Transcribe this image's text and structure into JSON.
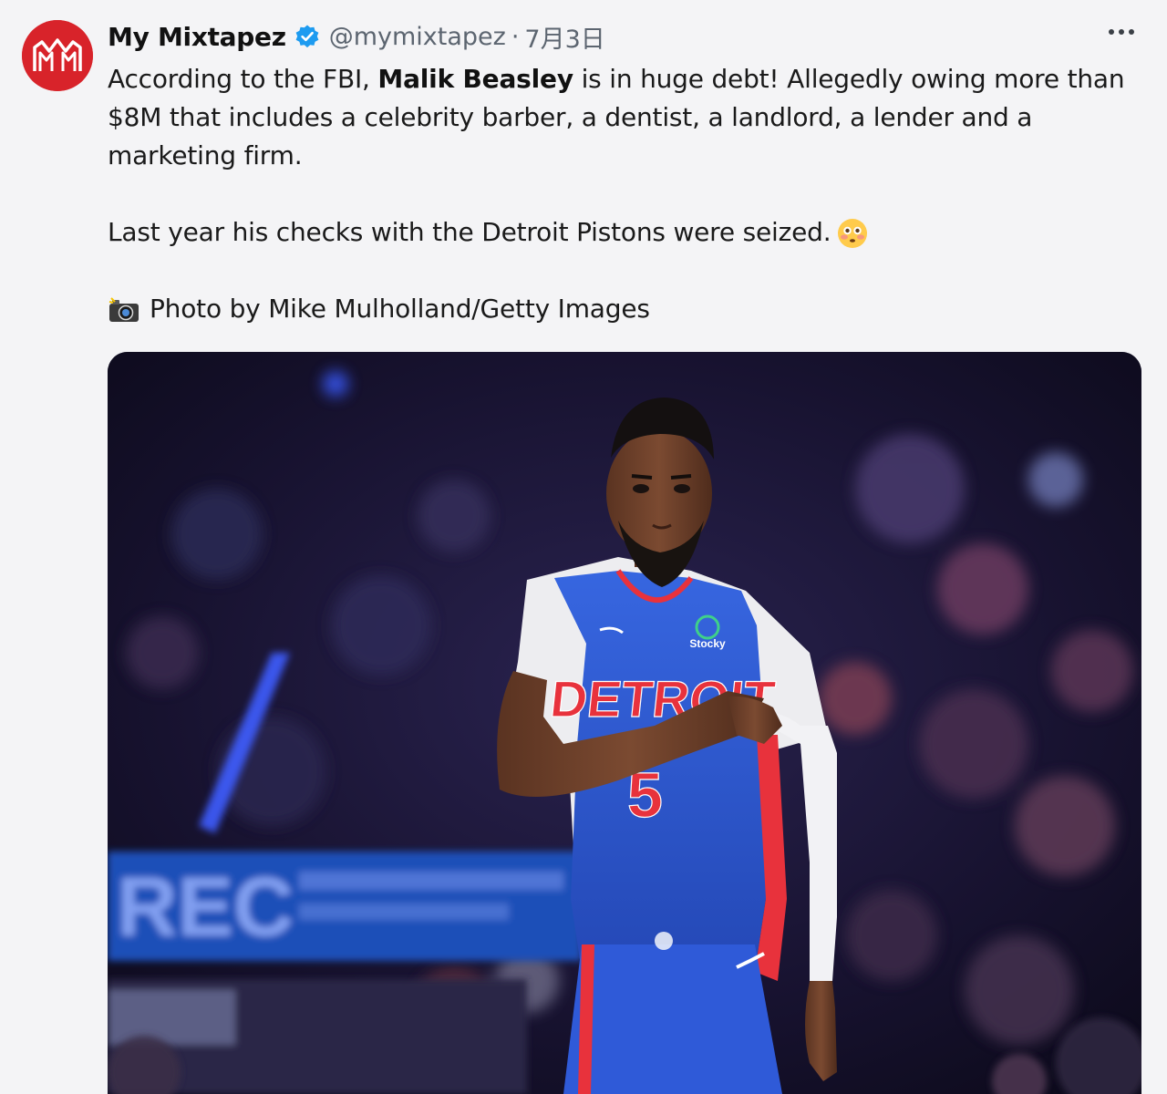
{
  "author": {
    "display_name": "My Mixtapez",
    "handle": "@mymixtapez",
    "separator": "·",
    "timestamp": "7月3日",
    "avatar_icon": "mm-logo-icon",
    "avatar_text": "MM",
    "verified_icon": "verified-badge-icon",
    "brand_color": "#d8232a",
    "verified_color": "#1d9bf0"
  },
  "tweet": {
    "line1_before": "According to the FBI, ",
    "line1_bold": "Malik Beasley",
    "line1_after": " is in huge debt! Allegedly owing more than $8M that includes a celebrity barber, a dentist, a landlord, a lender and a marketing firm.",
    "line2": "Last year his checks with the Detroit Pistons were seized.",
    "line2_emoji": "flushed-face-emoji",
    "credit_icon": "camera-flash-icon",
    "credit": "Photo by Mike Mulholland/Getty Images"
  },
  "media": {
    "jersey_text": "DETROIT",
    "jersey_number": "5",
    "patch_text": "Stocky",
    "banner_text": "REC",
    "jersey_color": "#2e5bd6",
    "accent_color": "#e8323c"
  },
  "more_icon": "more-dots-icon"
}
